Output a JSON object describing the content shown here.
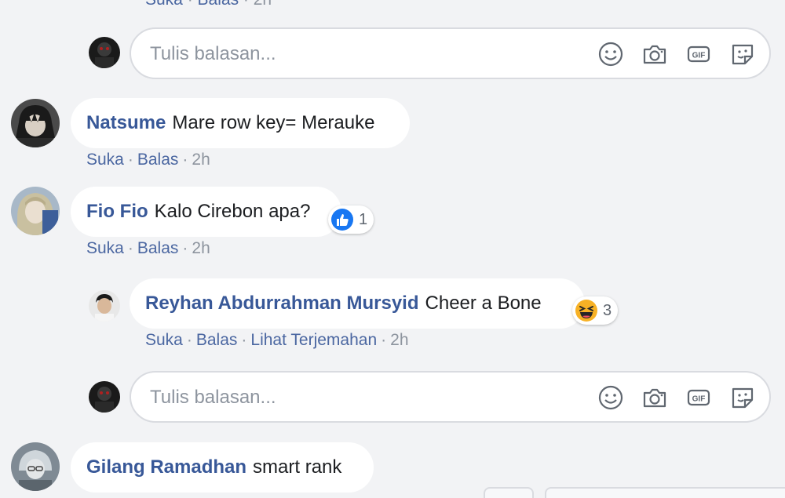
{
  "top_actions": {
    "like": "Suka",
    "reply": "Balas",
    "time": "2h"
  },
  "reply_box": {
    "placeholder": "Tulis balasan..."
  },
  "comments": [
    {
      "author": "Natsume",
      "text": "Mare row key= Merauke",
      "like": "Suka",
      "reply": "Balas",
      "time": "2h"
    },
    {
      "author": "Fio Fio",
      "text": "Kalo Cirebon apa?",
      "like": "Suka",
      "reply": "Balas",
      "time": "2h",
      "reaction": {
        "icon": "like-reaction-icon",
        "count": "1"
      }
    },
    {
      "author": "Reyhan Abdurrahman Mursyid",
      "text": "Cheer a Bone",
      "like": "Suka",
      "reply": "Balas",
      "translate": "Lihat Terjemahan",
      "time": "2h",
      "reaction": {
        "icon": "haha-reaction-icon",
        "count": "3"
      }
    },
    {
      "author": "Gilang Ramadhan",
      "text": "smart rank"
    }
  ],
  "colors": {
    "link": "#385898",
    "meta": "#8d949e",
    "background": "#f2f3f5",
    "like_blue": "#1877f2"
  },
  "icons": [
    "emoji-icon",
    "camera-icon",
    "gif-icon",
    "sticker-icon"
  ]
}
